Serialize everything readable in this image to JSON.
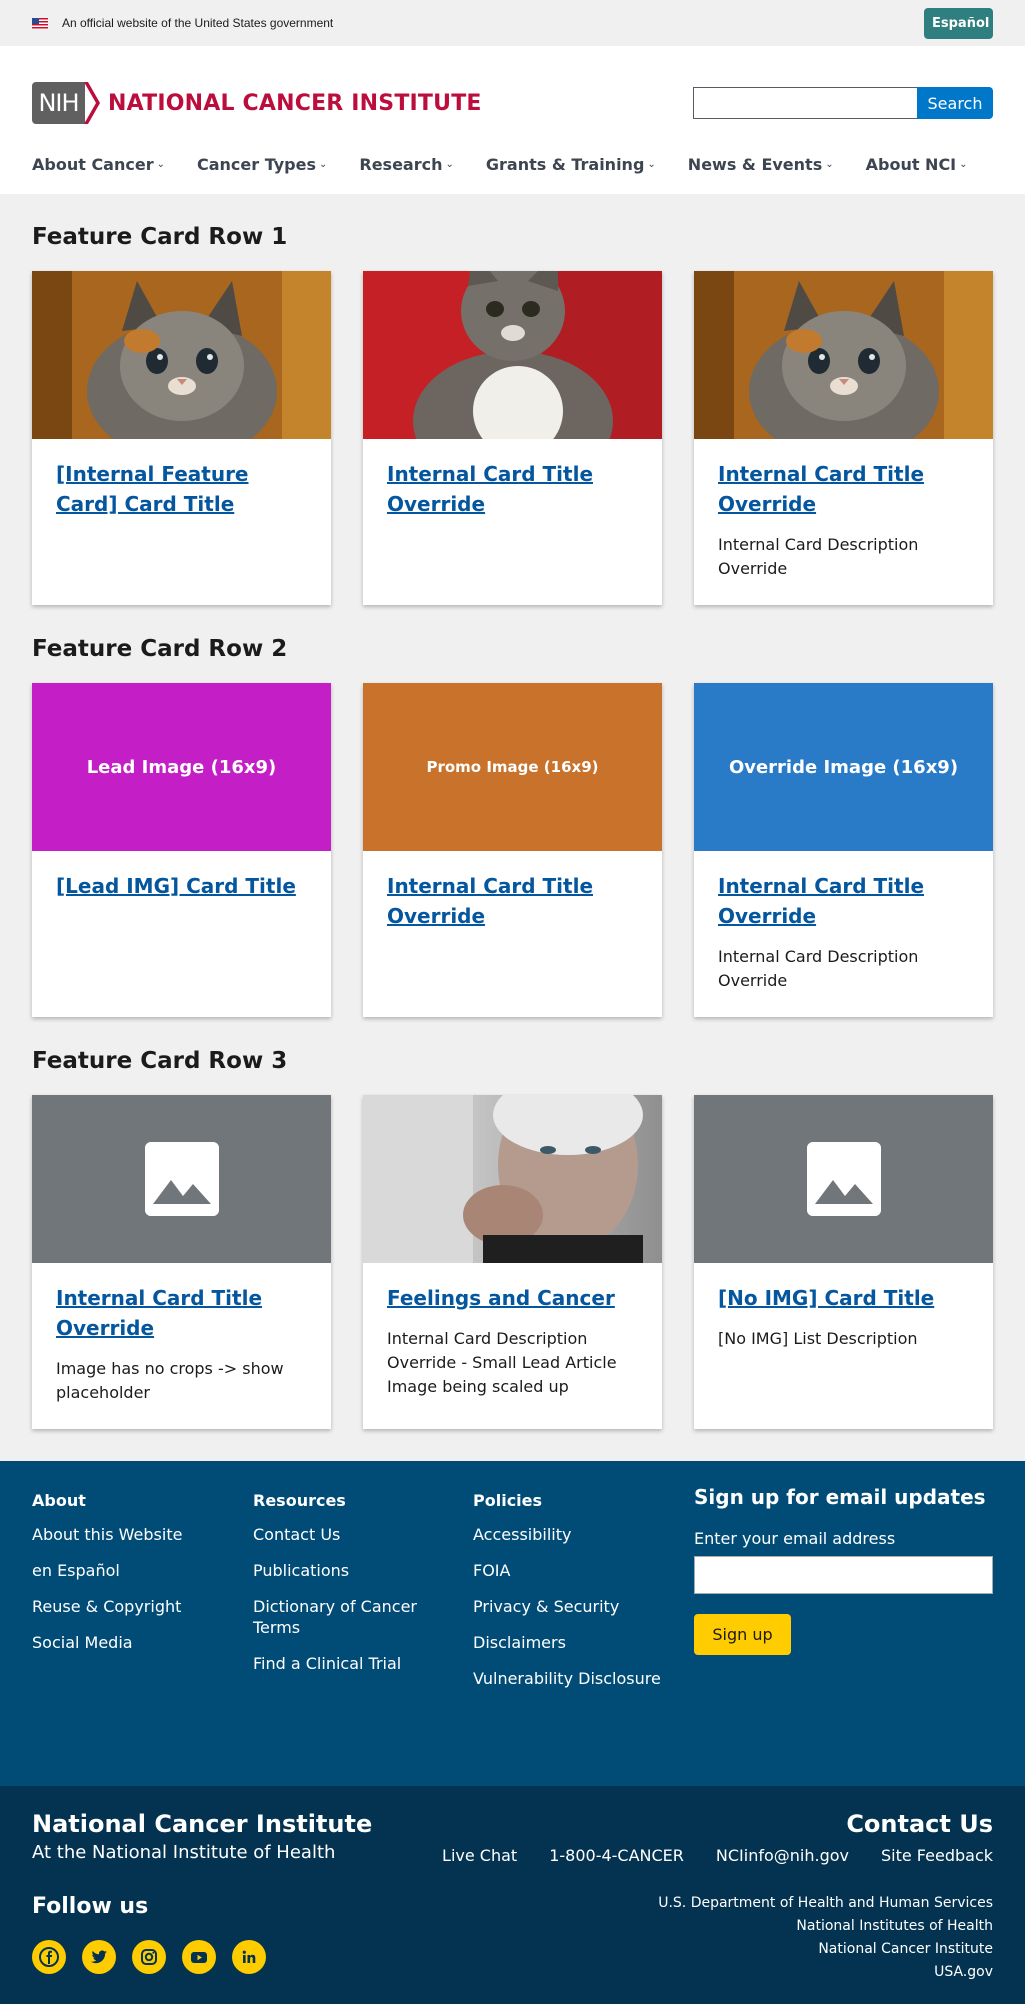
{
  "gov_banner": {
    "text": "An official website of the United States government",
    "espanol": "Español"
  },
  "header": {
    "nih": "NIH",
    "institute": "NATIONAL CANCER INSTITUTE",
    "search_button": "Search",
    "nav": [
      {
        "label": "About Cancer"
      },
      {
        "label": "Cancer Types"
      },
      {
        "label": "Research"
      },
      {
        "label": "Grants & Training"
      },
      {
        "label": "News & Events"
      },
      {
        "label": "About NCI"
      }
    ]
  },
  "rows": [
    {
      "title": "Feature Card Row 1",
      "cards": [
        {
          "title": "[Internal Feature Card] Card Title",
          "desc": "",
          "image": "kitten-tabby"
        },
        {
          "title": "Internal Card Title Override",
          "desc": "",
          "image": "kitten-red-background"
        },
        {
          "title": "Internal Card Title Override",
          "desc": "Internal Card Description Override",
          "image": "kitten-tabby"
        }
      ]
    },
    {
      "title": "Feature Card Row 2",
      "cards": [
        {
          "title": "[Lead IMG] Card Title",
          "desc": "",
          "image_text": "Lead Image (16x9)",
          "image_color": "#c41fc6"
        },
        {
          "title": "Internal Card Title Override",
          "desc": "",
          "image_text": "Promo Image (16x9)",
          "image_color": "#c8722b"
        },
        {
          "title": "Internal Card Title Override",
          "desc": "Internal Card Description Override",
          "image_text": "Override Image (16x9)",
          "image_color": "#2a7bc7"
        }
      ]
    },
    {
      "title": "Feature Card Row 3",
      "cards": [
        {
          "title": "Internal Card Title Override",
          "desc": "Image has no crops -> show placeholder",
          "image": "placeholder"
        },
        {
          "title": "Feelings and Cancer",
          "desc": "Internal Card Description Override - Small Lead Article Image being scaled up",
          "image": "elderly-woman"
        },
        {
          "title": "[No IMG] Card Title",
          "desc": "[No IMG] List Description",
          "image": "placeholder"
        }
      ]
    }
  ],
  "footer": {
    "about": {
      "head": "About",
      "links": [
        "About this Website",
        "en Español",
        "Reuse & Copyright",
        "Social Media"
      ]
    },
    "resources": {
      "head": "Resources",
      "links": [
        "Contact Us",
        "Publications",
        "Dictionary of Cancer Terms",
        "Find a Clinical Trial"
      ]
    },
    "policies": {
      "head": "Policies",
      "links": [
        "Accessibility",
        "FOIA",
        "Privacy & Security",
        "Disclaimers",
        "Vulnerability Disclosure"
      ]
    },
    "signup": {
      "title": "Sign up for email updates",
      "label": "Enter your email address",
      "button": "Sign up"
    }
  },
  "footer2": {
    "name": "National Cancer Institute",
    "sub": "At the National Institute of Health",
    "contact_title": "Contact Us",
    "contacts": [
      "Live Chat",
      "1-800-4-CANCER",
      "NCIinfo@nih.gov",
      "Site Feedback"
    ],
    "follow": "Follow us",
    "socials": [
      "facebook-icon",
      "twitter-icon",
      "instagram-icon",
      "youtube-icon",
      "linkedin-icon"
    ],
    "agencies": [
      "U.S. Department of Health and Human Services",
      "National Institutes of Health",
      "National Cancer Institute",
      "USA.gov"
    ]
  },
  "colors": {
    "brand_red": "#bb0e3d",
    "link_blue": "#04569e",
    "footer_blue": "#014c77",
    "footer_dark": "#033350",
    "accent_yellow": "#ffcc00"
  }
}
